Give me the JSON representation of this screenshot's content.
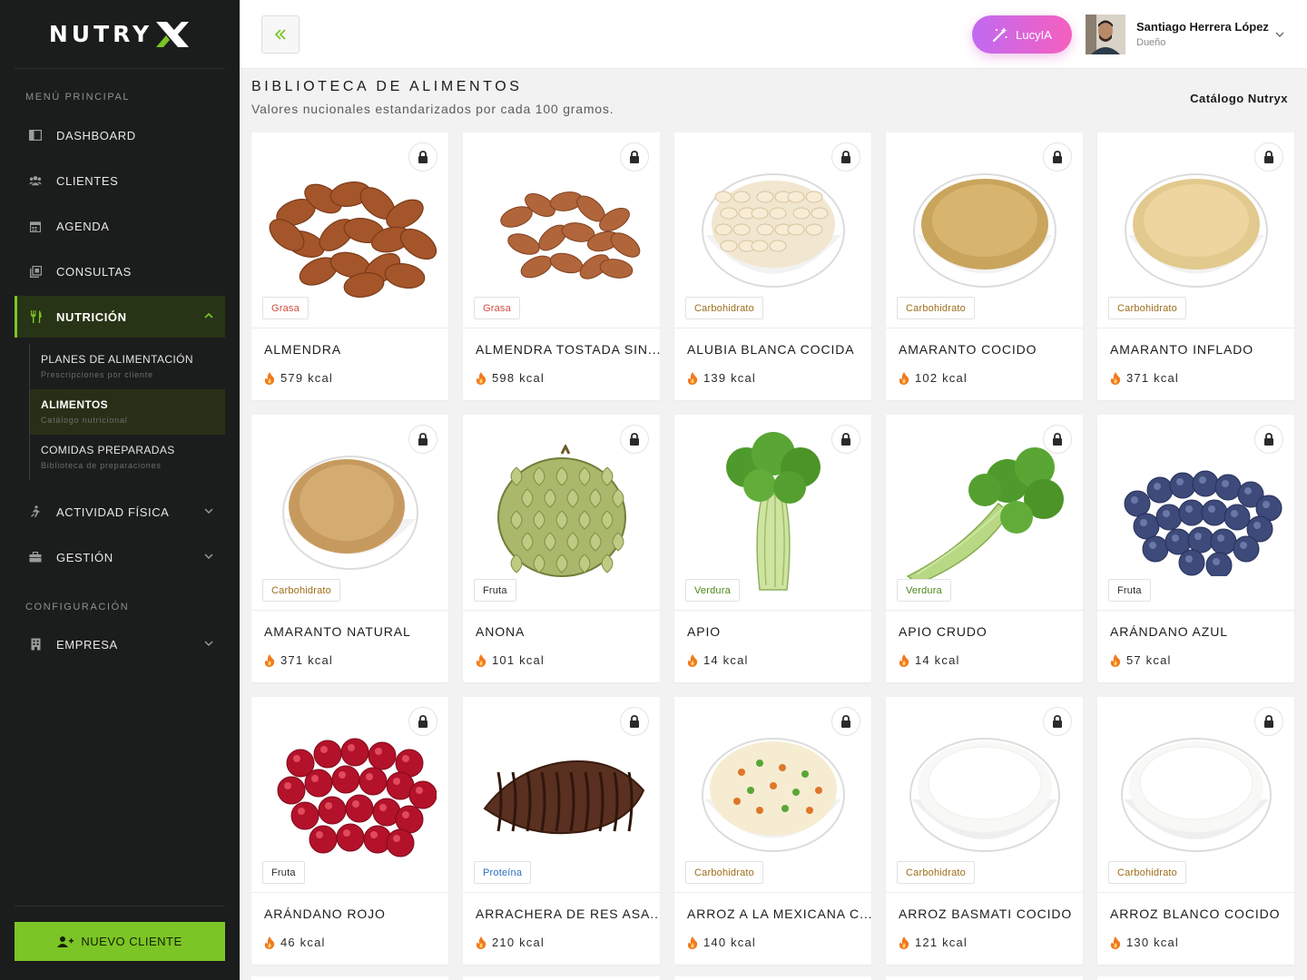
{
  "brand": {
    "name": "NUTRY"
  },
  "sidebar": {
    "main_menu_title": "MENÚ PRINCIPAL",
    "config_title": "CONFIGURACIÓN",
    "items": [
      {
        "label": "DASHBOARD",
        "icon": "dashboard-icon"
      },
      {
        "label": "CLIENTES",
        "icon": "users-icon"
      },
      {
        "label": "AGENDA",
        "icon": "calendar-icon"
      },
      {
        "label": "CONSULTAS",
        "icon": "consult-icon"
      },
      {
        "label": "NUTRICIÓN",
        "icon": "utensils-icon",
        "active": true,
        "expanded": true
      },
      {
        "label": "ACTIVIDAD FÍSICA",
        "icon": "running-icon"
      },
      {
        "label": "GESTIÓN",
        "icon": "briefcase-icon"
      },
      {
        "label": "EMPRESA",
        "icon": "building-icon"
      }
    ],
    "submenu": [
      {
        "title": "PLANES DE ALIMENTACIÓN",
        "desc": "Prescripciones por cliente"
      },
      {
        "title": "ALIMENTOS",
        "desc": "Catálogo nutricional",
        "active": true
      },
      {
        "title": "COMIDAS PREPARADAS",
        "desc": "Biblioteca de preparaciones"
      }
    ],
    "new_client_label": "NUEVO CLIENTE"
  },
  "topbar": {
    "ai_button_label": "LucyIA",
    "user": {
      "name": "Santiago Herrera López",
      "role": "Dueño"
    }
  },
  "page": {
    "title": "BIBLIOTECA DE ALIMENTOS",
    "subtitle": "Valores nucionales estandarizados por cada 100 gramos.",
    "catalog_label": "Catálogo Nutryx"
  },
  "foods": [
    {
      "name": "ALMENDRA",
      "kcal": "579 kcal",
      "category": "Grasa",
      "cls": "grasa",
      "img": "almond"
    },
    {
      "name": "ALMENDRA TOSTADA SIN...",
      "kcal": "598 kcal",
      "category": "Grasa",
      "cls": "grasa",
      "img": "almond-small"
    },
    {
      "name": "ALUBIA BLANCA COCIDA",
      "kcal": "139 kcal",
      "category": "Carbohidrato",
      "cls": "carb",
      "img": "beans"
    },
    {
      "name": "AMARANTO COCIDO",
      "kcal": "102 kcal",
      "category": "Carbohidrato",
      "cls": "carb",
      "img": "amaranth-cooked"
    },
    {
      "name": "AMARANTO INFLADO",
      "kcal": "371 kcal",
      "category": "Carbohidrato",
      "cls": "carb",
      "img": "amaranth-puffed"
    },
    {
      "name": "AMARANTO NATURAL",
      "kcal": "371 kcal",
      "category": "Carbohidrato",
      "cls": "carb",
      "img": "amaranth-raw"
    },
    {
      "name": "ANONA",
      "kcal": "101 kcal",
      "category": "Fruta",
      "cls": "fruta",
      "img": "anona"
    },
    {
      "name": "APIO",
      "kcal": "14 kcal",
      "category": "Verdura",
      "cls": "verdura",
      "img": "celery"
    },
    {
      "name": "APIO CRUDO",
      "kcal": "14 kcal",
      "category": "Verdura",
      "cls": "verdura",
      "img": "celery-leaf"
    },
    {
      "name": "ARÁNDANO AZUL",
      "kcal": "57 kcal",
      "category": "Fruta",
      "cls": "fruta",
      "img": "blueberry"
    },
    {
      "name": "ARÁNDANO ROJO",
      "kcal": "46 kcal",
      "category": "Fruta",
      "cls": "fruta",
      "img": "cranberry"
    },
    {
      "name": "ARRACHERA DE RES ASA...",
      "kcal": "210 kcal",
      "category": "Proteína",
      "cls": "proteina",
      "img": "steak"
    },
    {
      "name": "ARROZ A LA MEXICANA C...",
      "kcal": "140 kcal",
      "category": "Carbohidrato",
      "cls": "carb",
      "img": "rice-mex"
    },
    {
      "name": "ARROZ BASMATI COCIDO",
      "kcal": "121 kcal",
      "category": "Carbohidrato",
      "cls": "carb",
      "img": "rice-white"
    },
    {
      "name": "ARROZ BLANCO COCIDO",
      "kcal": "130 kcal",
      "category": "Carbohidrato",
      "cls": "carb",
      "img": "rice-white"
    }
  ],
  "colors": {
    "accent": "#7bc526",
    "sidebar_bg": "#1b1c1c",
    "grasa": "#d04b3c",
    "carbohidrato": "#9e6d1a",
    "verdura": "#4a8a1c",
    "proteina": "#2c6fc0"
  }
}
